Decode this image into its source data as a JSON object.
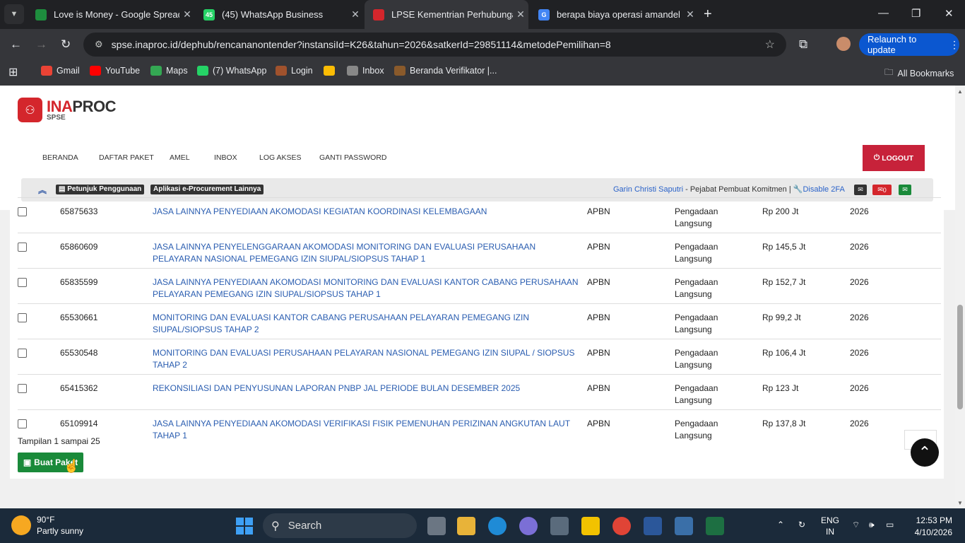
{
  "browser": {
    "tabs": [
      {
        "title": "Love is Money - Google Spread",
        "favicon_color": "#1e8e3e",
        "favicon_text": ""
      },
      {
        "title": "(45) WhatsApp Business",
        "favicon_color": "#25d366",
        "favicon_text": "45"
      },
      {
        "title": "LPSE Kementrian Perhubungan",
        "favicon_color": "#d4262c",
        "favicon_text": ""
      },
      {
        "title": "berapa biaya operasi amandel -",
        "favicon_color": "#4285f4",
        "favicon_text": "G"
      }
    ],
    "url": "spse.inaproc.id/dephub/rencananontender?instansiId=K26&tahun=2026&satkerId=29851114&metodePemilihan=8",
    "relaunch_label": "Relaunch to update",
    "bookmarks": [
      {
        "label": "Gmail",
        "icon": "gmail-icon",
        "color": "#ea4335"
      },
      {
        "label": "YouTube",
        "icon": "youtube-icon",
        "color": "#ff0000"
      },
      {
        "label": "Maps",
        "icon": "maps-icon",
        "color": "#34a853"
      },
      {
        "label": "(7) WhatsApp",
        "icon": "whatsapp-icon",
        "color": "#25d366"
      },
      {
        "label": "Login",
        "icon": "login-icon",
        "color": "#a0522d"
      },
      {
        "label": "",
        "icon": "pinwheel-icon",
        "color": "#fbbc04"
      },
      {
        "label": "Inbox",
        "icon": "mail-icon",
        "color": "#888888"
      },
      {
        "label": "Beranda Verifikator |...",
        "icon": "globe-icon",
        "color": "#8a5a2b"
      }
    ],
    "all_bookmarks": "All Bookmarks"
  },
  "site": {
    "logo_main": "INA",
    "logo_main2": "PROC",
    "logo_sub": "SPSE",
    "menu": [
      "BERANDA",
      "DAFTAR PAKET",
      "AMEL",
      "INBOX",
      "LOG AKSES",
      "GANTI PASSWORD"
    ],
    "logout": "LOGOUT",
    "badges": [
      "Petunjuk Penggunaan",
      "Aplikasi e-Procurement Lainnya"
    ],
    "user_name": "Garin Christi Saputri",
    "user_role": " - Pejabat Pembuat Komitmen | ",
    "disable_2fa": "Disable 2FA",
    "mail_count": "0"
  },
  "table": {
    "rows": [
      {
        "id": "65875633",
        "name": "JASA LAINNYA PENYEDIAAN AKOMODASI KEGIATAN KOORDINASI KELEMBAGAAN",
        "source": "APBN",
        "method": "Pengadaan Langsung",
        "pagu": "Rp 200 Jt",
        "year": "2026"
      },
      {
        "id": "65860609",
        "name": "JASA LAINNYA PENYELENGGARAAN AKOMODASI MONITORING DAN EVALUASI PERUSAHAAN PELAYARAN NASIONAL PEMEGANG IZIN SIUPAL/SIOPSUS TAHAP 1",
        "source": "APBN",
        "method": "Pengadaan Langsung",
        "pagu": "Rp 145,5 Jt",
        "year": "2026"
      },
      {
        "id": "65835599",
        "name": "JASA LAINNYA PENYEDIAAN AKOMODASI MONITORING DAN EVALUASI KANTOR CABANG PERUSAHAAN PELAYARAN PEMEGANG IZIN SIUPAL/SIOPSUS TAHAP 1",
        "source": "APBN",
        "method": "Pengadaan Langsung",
        "pagu": "Rp 152,7 Jt",
        "year": "2026"
      },
      {
        "id": "65530661",
        "name": "MONITORING DAN EVALUASI KANTOR CABANG PERUSAHAAN PELAYARAN PEMEGANG IZIN SIUPAL/SIOPSUS TAHAP 2",
        "source": "APBN",
        "method": "Pengadaan Langsung",
        "pagu": "Rp 99,2 Jt",
        "year": "2026"
      },
      {
        "id": "65530548",
        "name": "MONITORING DAN EVALUASI PERUSAHAAN PELAYARAN NASIONAL PEMEGANG IZIN SIUPAL / SIOPSUS TAHAP 2",
        "source": "APBN",
        "method": "Pengadaan Langsung",
        "pagu": "Rp 106,4 Jt",
        "year": "2026"
      },
      {
        "id": "65415362",
        "name": "REKONSILIASI DAN PENYUSUNAN LAPORAN PNBP JAL PERIODE BULAN DESEMBER 2025",
        "source": "APBN",
        "method": "Pengadaan Langsung",
        "pagu": "Rp 123 Jt",
        "year": "2026"
      },
      {
        "id": "65109914",
        "name": "JASA LAINNYA PENYEDIAAN AKOMODASI VERIFIKASI FISIK PEMENUHAN PERIZINAN ANGKUTAN LAUT TAHAP 1",
        "source": "APBN",
        "method": "Pengadaan Langsung",
        "pagu": "Rp 137,8 Jt",
        "year": "2026"
      }
    ],
    "footer_info": "Tampilan 1 sampai 25",
    "create_button": "Buat Paket"
  },
  "taskbar": {
    "temp": "90°F",
    "weather": "Partly sunny",
    "search_placeholder": "Search",
    "lang1": "ENG",
    "lang2": "IN",
    "time": "12:53 PM",
    "date": "4/10/2026"
  }
}
